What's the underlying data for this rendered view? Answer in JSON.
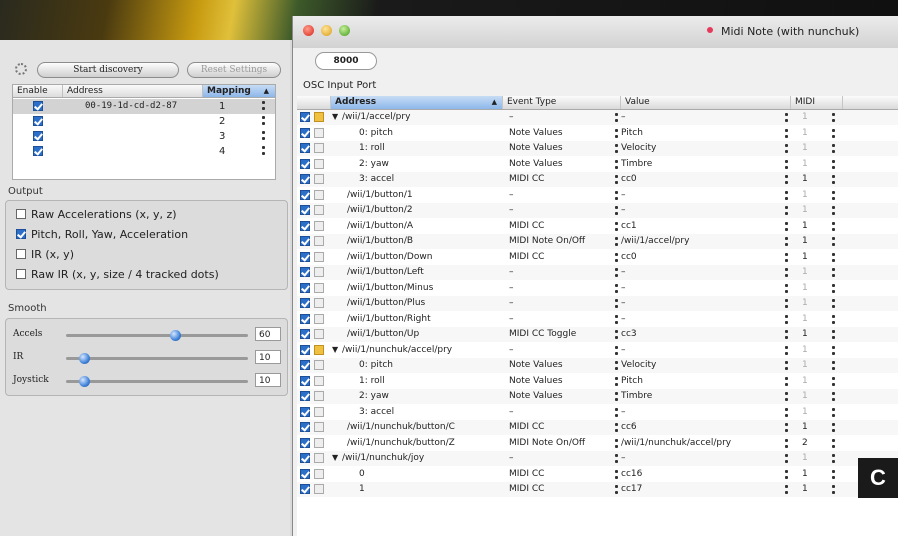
{
  "discovery": {
    "start_label": "Start discovery",
    "reset_label": "Reset Settings"
  },
  "mapping_table": {
    "headers": [
      "Enable",
      "Address",
      "Mapping"
    ],
    "rows": [
      {
        "enabled": true,
        "address": "00-19-1d-cd-d2-87",
        "mapping": "1",
        "selected": true
      },
      {
        "enabled": true,
        "address": "",
        "mapping": "2"
      },
      {
        "enabled": true,
        "address": "",
        "mapping": "3"
      },
      {
        "enabled": true,
        "address": "",
        "mapping": "4"
      }
    ]
  },
  "output": {
    "label": "Output",
    "options": [
      {
        "label": "Raw Accelerations (x, y, z)",
        "checked": false
      },
      {
        "label": "Pitch, Roll, Yaw, Acceleration",
        "checked": true
      },
      {
        "label": "IR (x, y)",
        "checked": false
      },
      {
        "label": "Raw IR (x, y, size / 4 tracked dots)",
        "checked": false
      }
    ]
  },
  "smooth": {
    "label": "Smooth",
    "sliders": [
      {
        "label": "Accels",
        "value": "60",
        "level": 0.6
      },
      {
        "label": "IR",
        "value": "10",
        "level": 0.1
      },
      {
        "label": "Joystick",
        "value": "10",
        "level": 0.1
      }
    ]
  },
  "right": {
    "mode_label": "Midi Note (with nunchuk)",
    "port_value": "8000",
    "osc_label": "OSC Input Port",
    "headers": [
      "Address",
      "Event Type",
      "Value",
      "MIDI"
    ]
  },
  "osc_rows": [
    {
      "address": "/wii/1/accel/pry",
      "indent": 0,
      "expand": true,
      "group": true,
      "type": "–",
      "value": "–",
      "midi": "1",
      "dim": true
    },
    {
      "address": "0: pitch",
      "indent": 1,
      "type": "Note Values",
      "value": "Pitch",
      "midi": "1",
      "dim": true
    },
    {
      "address": "1: roll",
      "indent": 1,
      "type": "Note Values",
      "value": "Velocity",
      "midi": "1",
      "dim": true
    },
    {
      "address": "2: yaw",
      "indent": 1,
      "type": "Note Values",
      "value": "Timbre",
      "midi": "1",
      "dim": true
    },
    {
      "address": "3: accel",
      "indent": 1,
      "type": "MIDI CC",
      "value": "cc0",
      "midi": "1",
      "dim": false
    },
    {
      "address": "/wii/1/button/1",
      "indent": 0,
      "type": "–",
      "value": "–",
      "midi": "1",
      "dim": true
    },
    {
      "address": "/wii/1/button/2",
      "indent": 0,
      "type": "–",
      "value": "–",
      "midi": "1",
      "dim": true
    },
    {
      "address": "/wii/1/button/A",
      "indent": 0,
      "type": "MIDI CC",
      "value": "cc1",
      "midi": "1",
      "dim": false
    },
    {
      "address": "/wii/1/button/B",
      "indent": 0,
      "type": "MIDI Note On/Off",
      "value": "/wii/1/accel/pry",
      "midi": "1",
      "dim": false
    },
    {
      "address": "/wii/1/button/Down",
      "indent": 0,
      "type": "MIDI CC",
      "value": "cc0",
      "midi": "1",
      "dim": false
    },
    {
      "address": "/wii/1/button/Left",
      "indent": 0,
      "type": "–",
      "value": "–",
      "midi": "1",
      "dim": true
    },
    {
      "address": "/wii/1/button/Minus",
      "indent": 0,
      "type": "–",
      "value": "–",
      "midi": "1",
      "dim": true
    },
    {
      "address": "/wii/1/button/Plus",
      "indent": 0,
      "type": "–",
      "value": "–",
      "midi": "1",
      "dim": true
    },
    {
      "address": "/wii/1/button/Right",
      "indent": 0,
      "type": "–",
      "value": "–",
      "midi": "1",
      "dim": true
    },
    {
      "address": "/wii/1/button/Up",
      "indent": 0,
      "type": "MIDI CC Toggle",
      "value": "cc3",
      "midi": "1",
      "dim": false
    },
    {
      "address": "/wii/1/nunchuk/accel/pry",
      "indent": 0,
      "expand": true,
      "group": true,
      "type": "–",
      "value": "–",
      "midi": "1",
      "dim": true
    },
    {
      "address": "0: pitch",
      "indent": 1,
      "type": "Note Values",
      "value": "Velocity",
      "midi": "1",
      "dim": true
    },
    {
      "address": "1: roll",
      "indent": 1,
      "type": "Note Values",
      "value": "Pitch",
      "midi": "1",
      "dim": true
    },
    {
      "address": "2: yaw",
      "indent": 1,
      "type": "Note Values",
      "value": "Timbre",
      "midi": "1",
      "dim": true
    },
    {
      "address": "3: accel",
      "indent": 1,
      "type": "–",
      "value": "–",
      "midi": "1",
      "dim": true
    },
    {
      "address": "/wii/1/nunchuk/button/C",
      "indent": 0,
      "type": "MIDI CC",
      "value": "cc6",
      "midi": "1",
      "dim": false
    },
    {
      "address": "/wii/1/nunchuk/button/Z",
      "indent": 0,
      "type": "MIDI Note On/Off",
      "value": "/wii/1/nunchuk/accel/pry",
      "midi": "2",
      "dim": false
    },
    {
      "address": "/wii/1/nunchuk/joy",
      "indent": 0,
      "expand": true,
      "type": "–",
      "value": "–",
      "midi": "1",
      "dim": true
    },
    {
      "address": "0",
      "indent": 1,
      "type": "MIDI CC",
      "value": "cc16",
      "midi": "1",
      "dim": false
    },
    {
      "address": "1",
      "indent": 1,
      "type": "MIDI CC",
      "value": "cc17",
      "midi": "1",
      "dim": false
    }
  ],
  "panel_letter": "C"
}
